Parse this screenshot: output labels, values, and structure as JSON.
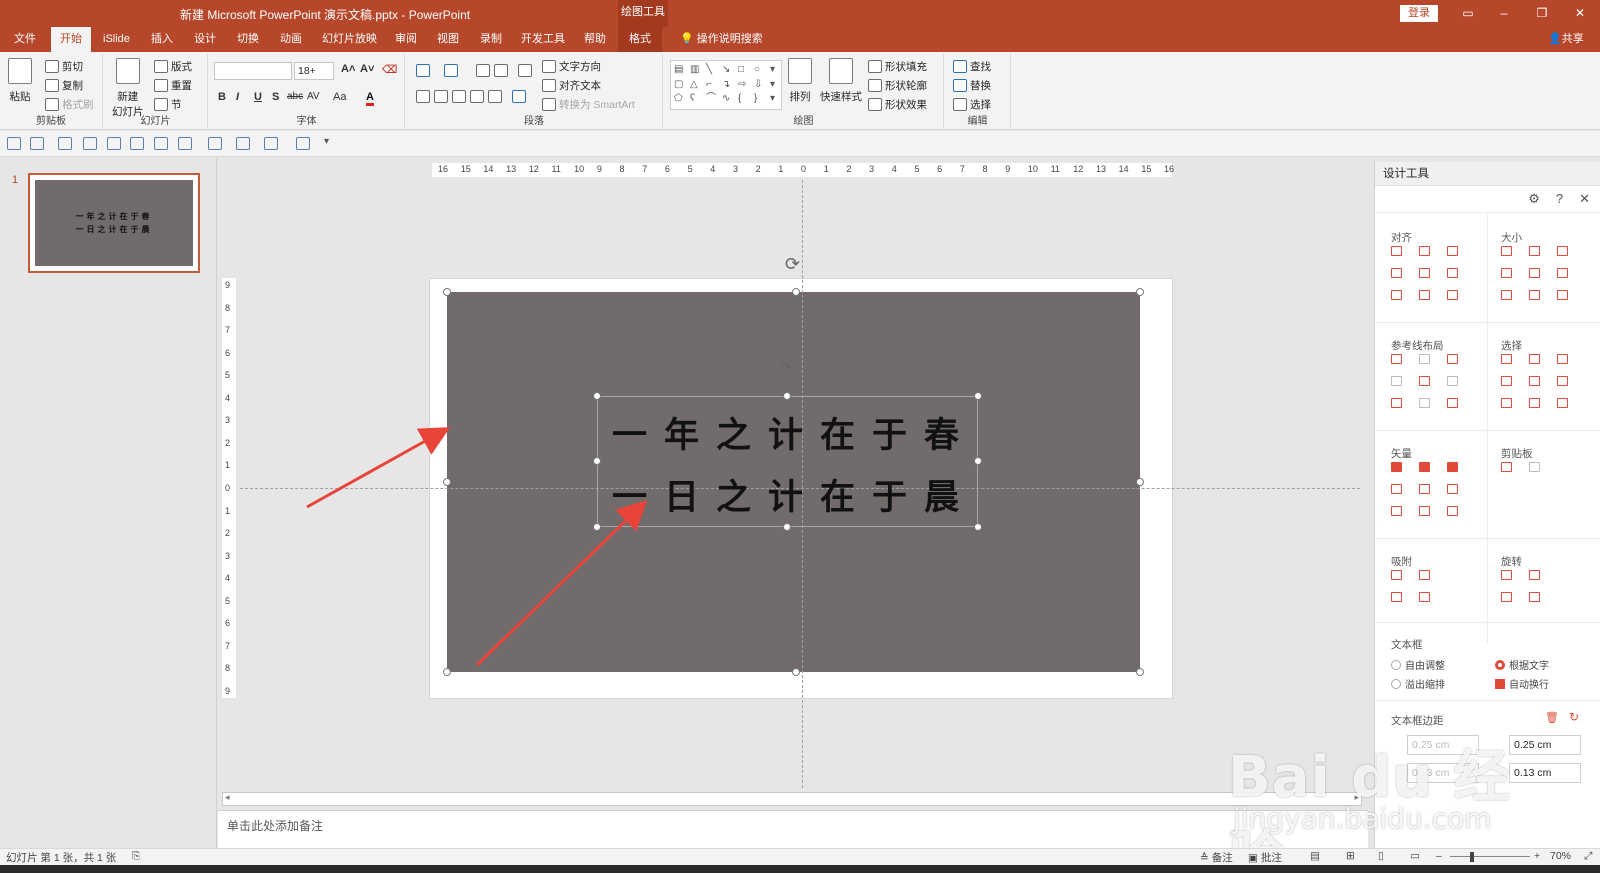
{
  "titlebar": {
    "title": "新建 Microsoft PowerPoint 演示文稿.pptx  -  PowerPoint",
    "context_tab": "绘图工具",
    "login": "登录",
    "min": "–",
    "max": "❐",
    "close": "✕"
  },
  "tabs": {
    "file": "文件",
    "home": "开始",
    "islide": "iSlide",
    "insert": "插入",
    "design": "设计",
    "transitions": "切换",
    "animations": "动画",
    "slideshow": "幻灯片放映",
    "review": "审阅",
    "view": "视图",
    "record": "录制",
    "developer": "开发工具",
    "help": "帮助",
    "format": "格式",
    "tellme": "操作说明搜索",
    "share": "共享"
  },
  "ribbon": {
    "clipboard": {
      "paste": "粘贴",
      "cut": "剪切",
      "copy": "复制",
      "format_painter": "格式刷",
      "label": "剪贴板"
    },
    "slides": {
      "new_slide": "新建\n幻灯片",
      "layout": "版式",
      "reset": "重置",
      "section": "节",
      "label": "幻灯片"
    },
    "font": {
      "name": "",
      "size": "18+",
      "label": "字体",
      "bold": "B",
      "italic": "I",
      "underline": "U",
      "shadow": "S",
      "strike": "abc",
      "spacing": "AV",
      "case": "Aa",
      "color": "A"
    },
    "paragraph": {
      "text_direction": "文字方向",
      "align_text": "对齐文本",
      "smartart": "转换为 SmartArt",
      "label": "段落"
    },
    "drawing": {
      "arrange": "排列",
      "quick_styles": "快速样式",
      "shape_fill": "形状填充",
      "shape_outline": "形状轮廓",
      "shape_effects": "形状效果",
      "label": "绘图"
    },
    "editing": {
      "find": "查找",
      "replace": "替换",
      "select": "选择",
      "label": "编辑"
    }
  },
  "thumbnail": {
    "number": "1",
    "line1": "一年之计在于春",
    "line2": "一日之计在于晨"
  },
  "slide": {
    "line1": "一年之计在于春",
    "line2": "一日之计在于晨",
    "bg_color": "#716c6b",
    "arrow_color": "#e8443a"
  },
  "ruler": {
    "h_labels": [
      "16",
      "15",
      "14",
      "13",
      "12",
      "11",
      "10",
      "9",
      "8",
      "7",
      "6",
      "5",
      "4",
      "3",
      "2",
      "1",
      "0",
      "1",
      "2",
      "3",
      "4",
      "5",
      "6",
      "7",
      "8",
      "9",
      "10",
      "11",
      "12",
      "13",
      "14",
      "15",
      "16"
    ],
    "v_labels": [
      "9",
      "8",
      "7",
      "6",
      "5",
      "4",
      "3",
      "2",
      "1",
      "0",
      "1",
      "2",
      "3",
      "4",
      "5",
      "6",
      "7",
      "8",
      "9"
    ]
  },
  "notes": {
    "placeholder": "单击此处添加备注"
  },
  "panel": {
    "title": "设计工具",
    "sections": {
      "align": "对齐",
      "size": "大小",
      "guides": "参考线布局",
      "select": "选择",
      "vector": "矢量",
      "clipboard": "剪贴板",
      "snap": "吸附",
      "rotate": "旋转",
      "textbox": "文本框",
      "margins": "文本框边距"
    },
    "textbox_options": {
      "auto_fit": "自由调整",
      "fit_text": "根据文字",
      "overflow": "溢出缩排",
      "wrap": "自动换行"
    },
    "margins": {
      "left": "0.25 cm",
      "right": "0.25 cm",
      "top": "0.13 cm",
      "bottom": "0.13 cm"
    }
  },
  "status": {
    "slide_info": "幻灯片 第 1 张，共 1 张",
    "notes": "备注",
    "comments": "批注",
    "zoom": "70%"
  },
  "watermark": {
    "brand": "Bai du 经验",
    "url": "jingyan.baidu.com"
  }
}
